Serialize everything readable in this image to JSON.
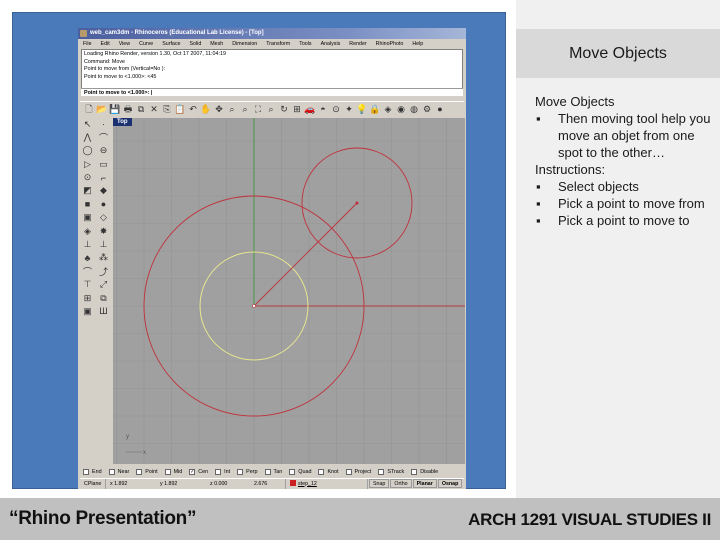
{
  "slide": {
    "header": "Move Objects",
    "intro": "Move Objects",
    "description_bullets": [
      "Then moving tool help you move an objet from one spot to the other…"
    ],
    "instructions_label": "Instructions:",
    "instruction_bullets": [
      "Select objects",
      "Pick a point to move from",
      "Pick a point to move to"
    ],
    "bullet_char": "▪",
    "footer_left": "“Rhino Presentation”",
    "footer_right": "ARCH 1291 VISUAL STUDIES II"
  },
  "rhino": {
    "title": "web_cam3dm - Rhinoceros (Educational Lab License) - [Top]",
    "menu": [
      "File",
      "Edit",
      "View",
      "Curve",
      "Surface",
      "Solid",
      "Mesh",
      "Dimension",
      "Transform",
      "Tools",
      "Analysis",
      "Render",
      "RhinoPhoto",
      "Help"
    ],
    "command_history": [
      "Loading Rhino Render, version 1.30, Oct 17 2007, 11:04:19",
      "Command: Move",
      "Point to move from (Vertical=No ):",
      "Point to move to <1.000>: <45"
    ],
    "command_prompt": "Point to move to <1.000>: |",
    "toolbar_top_icons": [
      {
        "name": "new-file-icon",
        "glyph": "🗋"
      },
      {
        "name": "open-folder-icon",
        "glyph": "📂"
      },
      {
        "name": "save-icon",
        "glyph": "💾"
      },
      {
        "name": "print-icon",
        "glyph": "🖶"
      },
      {
        "name": "import-icon",
        "glyph": "⧉"
      },
      {
        "name": "cut-icon",
        "glyph": "✕"
      },
      {
        "name": "copy-icon",
        "glyph": "⎘"
      },
      {
        "name": "paste-icon",
        "glyph": "📋"
      },
      {
        "name": "undo-icon",
        "glyph": "↶"
      },
      {
        "name": "pan-hand-icon",
        "glyph": "✋"
      },
      {
        "name": "rotate-view-icon",
        "glyph": "✥"
      },
      {
        "name": "zoom-icon",
        "glyph": "⌕"
      },
      {
        "name": "zoom-window-icon",
        "glyph": "⌕"
      },
      {
        "name": "zoom-extents-icon",
        "glyph": "⛶"
      },
      {
        "name": "zoom-selected-icon",
        "glyph": "⌕"
      },
      {
        "name": "set-view-icon",
        "glyph": "↻"
      },
      {
        "name": "four-viewports-icon",
        "glyph": "⊞"
      },
      {
        "name": "shaded-car-icon",
        "glyph": "🚗"
      },
      {
        "name": "rendered-icon",
        "glyph": "◓"
      },
      {
        "name": "select-icon",
        "glyph": "⊙"
      },
      {
        "name": "light-icon",
        "glyph": "✦"
      },
      {
        "name": "bulb-icon",
        "glyph": "💡"
      },
      {
        "name": "lock-icon",
        "glyph": "🔒"
      },
      {
        "name": "layers-icon",
        "glyph": "◈"
      },
      {
        "name": "color-wheel-icon",
        "glyph": "◉"
      },
      {
        "name": "material-icon",
        "glyph": "◍"
      },
      {
        "name": "options-gear-icon",
        "glyph": "⚙"
      },
      {
        "name": "help-icon",
        "glyph": "●"
      }
    ],
    "toolbar_left_icons": [
      {
        "name": "select-arrow-icon",
        "glyph": "↖"
      },
      {
        "name": "point-icon",
        "glyph": "·"
      },
      {
        "name": "polyline-icon",
        "glyph": "⋀"
      },
      {
        "name": "curve-icon",
        "glyph": "⌒"
      },
      {
        "name": "circle-icon",
        "glyph": "◯"
      },
      {
        "name": "ellipse-icon",
        "glyph": "⊖"
      },
      {
        "name": "arc-icon",
        "glyph": "▷"
      },
      {
        "name": "rectangle-icon",
        "glyph": "▭"
      },
      {
        "name": "polygon-icon",
        "glyph": "⊙"
      },
      {
        "name": "fillet-icon",
        "glyph": "⌐"
      },
      {
        "name": "surface-icon",
        "glyph": "◩"
      },
      {
        "name": "extrude-icon",
        "glyph": "◆"
      },
      {
        "name": "box-icon",
        "glyph": "■"
      },
      {
        "name": "sphere-icon",
        "glyph": "●"
      },
      {
        "name": "cylinder-icon",
        "glyph": "▣"
      },
      {
        "name": "boolean-icon",
        "glyph": "◇"
      },
      {
        "name": "mesh-icon",
        "glyph": "◈"
      },
      {
        "name": "explode-icon",
        "glyph": "✸"
      },
      {
        "name": "trim-icon",
        "glyph": "⊥"
      },
      {
        "name": "split-icon",
        "glyph": "⊥"
      },
      {
        "name": "join-icon",
        "glyph": "♣"
      },
      {
        "name": "group-icon",
        "glyph": "⁂"
      },
      {
        "name": "offset-icon",
        "glyph": "⌒"
      },
      {
        "name": "blend-icon",
        "glyph": "⤴"
      },
      {
        "name": "dimension-icon",
        "glyph": "⊤"
      },
      {
        "name": "control-points-icon",
        "glyph": "⤢"
      },
      {
        "name": "array-icon",
        "glyph": "⊞"
      },
      {
        "name": "transform-icon",
        "glyph": "⧉"
      },
      {
        "name": "render-icon",
        "glyph": "▣"
      },
      {
        "name": "analyze-icon",
        "glyph": "Ш"
      }
    ],
    "viewport_label": "Top",
    "osnaps": [
      {
        "label": "End",
        "checked": false
      },
      {
        "label": "Near",
        "checked": false
      },
      {
        "label": "Point",
        "checked": false
      },
      {
        "label": "Mid",
        "checked": false
      },
      {
        "label": "Cen",
        "checked": true
      },
      {
        "label": "Int",
        "checked": false
      },
      {
        "label": "Perp",
        "checked": false
      },
      {
        "label": "Tan",
        "checked": false
      },
      {
        "label": "Quad",
        "checked": false
      },
      {
        "label": "Knot",
        "checked": false
      },
      {
        "label": "Project",
        "checked": false
      },
      {
        "label": "STrack",
        "checked": false
      },
      {
        "label": "Disable",
        "checked": false
      }
    ],
    "status": {
      "cplane": "CPlane",
      "x": "x 1.892",
      "y": "y 1.892",
      "z": "z 0.000",
      "distance": "2.676",
      "layer": "step_12",
      "layer_color": "#cc1f1f",
      "snap": "Snap",
      "ortho": "Ortho",
      "planar": "Planar",
      "osnap": "Osnap"
    },
    "axis_labels": {
      "y": "y",
      "x": "x"
    },
    "colors": {
      "grid_bg": "#a0a0a0",
      "grid_line": "#939393",
      "y_axis": "#3f9a3f",
      "x_axis": "#b43c3c",
      "curve_red": "#c0303a",
      "curve_yellow": "#e8e890"
    }
  }
}
